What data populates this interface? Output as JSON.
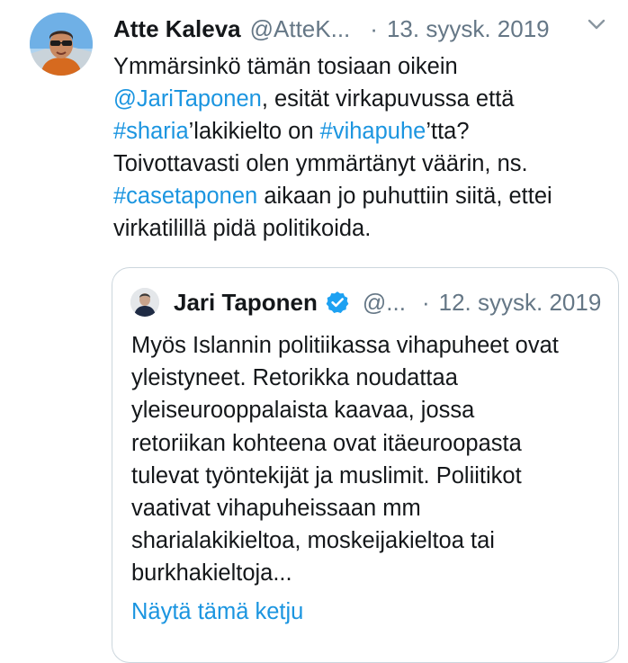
{
  "tweet": {
    "author_name": "Atte Kaleva",
    "author_handle": "@AtteK...",
    "separator": "·",
    "date": "13. syysk. 2019",
    "body": {
      "line1": "Ymmärsinkö tämän tosiaan oikein",
      "mention": "@JariTaponen",
      "line2_rest": ", esität virkapuvussa että",
      "hashtag1": "#sharia",
      "mid1": "’lakikielto on ",
      "hashtag2": "#vihapuhe",
      "mid2": "’tta?",
      "line4": "Toivottavasti olen ymmärtänyt väärin, ns.",
      "hashtag3": "#casetaponen",
      "line5_rest": " aikaan jo puhuttiin siitä, ettei",
      "line6": "virkatilillä pidä politikoida."
    }
  },
  "quoted_tweet": {
    "author_name": "Jari Taponen",
    "author_handle": "@...",
    "separator": "·",
    "date": "12. syysk. 2019",
    "lines": [
      "Myös Islannin politiikassa vihapuheet ovat",
      "yleistyneet. Retorikka noudattaa",
      "yleiseurooppalaista kaavaa, jossa",
      "retoriikan kohteena ovat itäeuroopasta",
      "tulevat työntekijät ja muslimit. Poliitikot",
      "vaativat vihapuheissaan mm",
      "sharialakikieltoa, moskeijakieltoa tai",
      "burkhakieltoja..."
    ],
    "show_thread": "Näytä tämä ketju"
  },
  "icons": {
    "menu": "chevron-down-icon",
    "verified": "verified-badge-icon"
  },
  "colors": {
    "link": "#1b95e0",
    "muted": "#657786",
    "border": "#ccd6dd",
    "verified": "#1da1f2"
  }
}
